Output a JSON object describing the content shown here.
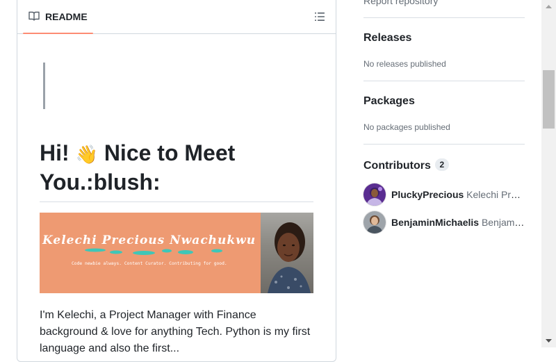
{
  "readme": {
    "tab_label": "README",
    "heading_line1": "Hi! ",
    "heading_emoji": "👋",
    "heading_line1_rest": " Nice to Meet",
    "heading_line2": "You.:blush:",
    "banner": {
      "name": "Kelechi Precious Nwachukwu",
      "tagline": "Code newbie always. Content Curator. Contributing for good."
    },
    "paragraph": "I'm Kelechi, a Project Manager with Finance background & love for anything Tech. Python is my first language and also the first..."
  },
  "sidebar": {
    "report_link": "Report repository",
    "releases": {
      "title": "Releases",
      "empty": "No releases published"
    },
    "packages": {
      "title": "Packages",
      "empty": "No packages published"
    },
    "contributors": {
      "title": "Contributors",
      "count": "2",
      "items": [
        {
          "login": "PluckyPrecious",
          "name": "Kelechi Precious Nwachukwu"
        },
        {
          "login": "BenjaminMichaelis",
          "name": "Benjamin Michaelis"
        }
      ]
    }
  },
  "colors": {
    "accent_underline": "#fd8c73",
    "banner_bg": "#ee9a72",
    "banner_strokes": "#3fc6b7"
  }
}
